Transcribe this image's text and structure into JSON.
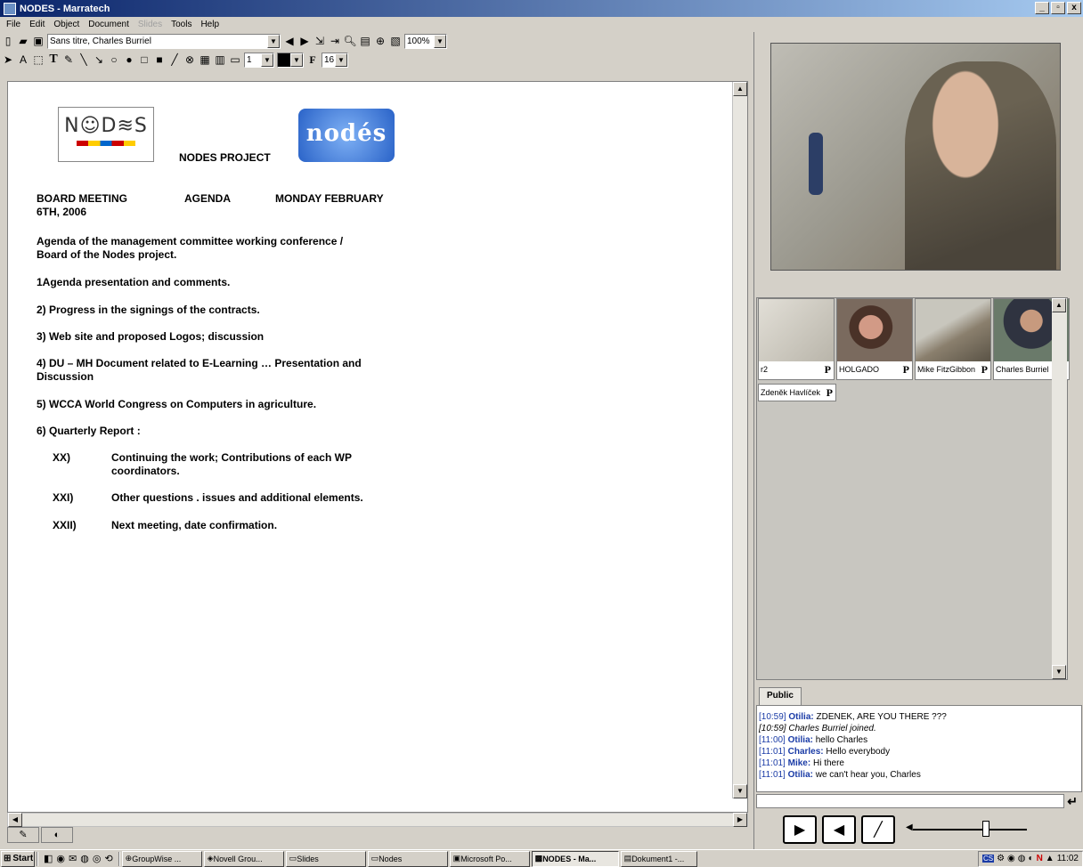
{
  "window": {
    "title": "NODES - Marratech",
    "buttons": [
      "_",
      "▫",
      "x"
    ]
  },
  "menu": [
    "File",
    "Edit",
    "Object",
    "Document",
    "Slides",
    "Tools",
    "Help"
  ],
  "toolbar": {
    "document_selector": "Sans titre, Charles Burriel",
    "zoom": "100%",
    "line_width": "1",
    "font_size": "16"
  },
  "document": {
    "logo_text": "N☺D≋S",
    "logo2_text": "nodés",
    "project_title": "NODES PROJECT",
    "meeting_line": [
      "BOARD MEETING",
      "AGENDA",
      "MONDAY FEBRUARY"
    ],
    "date_line": "6TH, 2006",
    "intro": [
      "Agenda of the management committee working conference /",
      "Board of the Nodes project."
    ],
    "items": [
      "1Agenda presentation and comments.",
      "2) Progress in the signings of the contracts.",
      "3) Web site and proposed Logos; discussion",
      "4) DU – MH Document related to E-Learning … Presentation and",
      "Discussion",
      "5) WCCA World Congress on Computers in agriculture.",
      "6) Quarterly Report :"
    ],
    "subitems": [
      {
        "num": "XX)",
        "lines": [
          "Continuing the work; Contributions of each WP",
          "coordinators."
        ]
      },
      {
        "num": "XXI)",
        "lines": [
          "Other questions . issues and additional elements."
        ]
      },
      {
        "num": "XXII)",
        "lines": [
          "Next meeting, date confirmation."
        ]
      }
    ]
  },
  "participants": [
    {
      "name": "r2",
      "mark": "P"
    },
    {
      "name": "HOLGADO",
      "mark": "P"
    },
    {
      "name": "Mike FitzGibbon",
      "mark": "P"
    },
    {
      "name": "Charles Burriel",
      "mark": "P"
    },
    {
      "name": "Zdeněk Havlíček",
      "mark": "P"
    }
  ],
  "chat": {
    "tab": "Public",
    "lines": [
      {
        "ts": "[10:59]",
        "who": "Otilia:",
        "msg": " ZDENEK, ARE YOU THERE ???"
      },
      {
        "sys": true,
        "text": "[10:59] Charles Burriel joined."
      },
      {
        "ts": "[11:00]",
        "who": "Otilia:",
        "msg": " hello Charles"
      },
      {
        "ts": "[11:01]",
        "who": "Charles:",
        "msg": " Hello everybody"
      },
      {
        "ts": "[11:01]",
        "who": "Mike:",
        "msg": " Hi there"
      },
      {
        "ts": "[11:01]",
        "who": "Otilia:",
        "msg": " we can't hear you, Charles"
      }
    ]
  },
  "taskbar": {
    "start": "Start",
    "tasks": [
      {
        "label": "GroupWise ...",
        "active": false
      },
      {
        "label": "Novell Grou...",
        "active": false
      },
      {
        "label": "Slides",
        "active": false
      },
      {
        "label": "Nodes",
        "active": false
      },
      {
        "label": "Microsoft Po...",
        "active": false
      },
      {
        "label": "NODES - Ma...",
        "active": true
      },
      {
        "label": "Dokument1 -...",
        "active": false
      }
    ],
    "clock": "11:02",
    "tray_label": "CS"
  }
}
